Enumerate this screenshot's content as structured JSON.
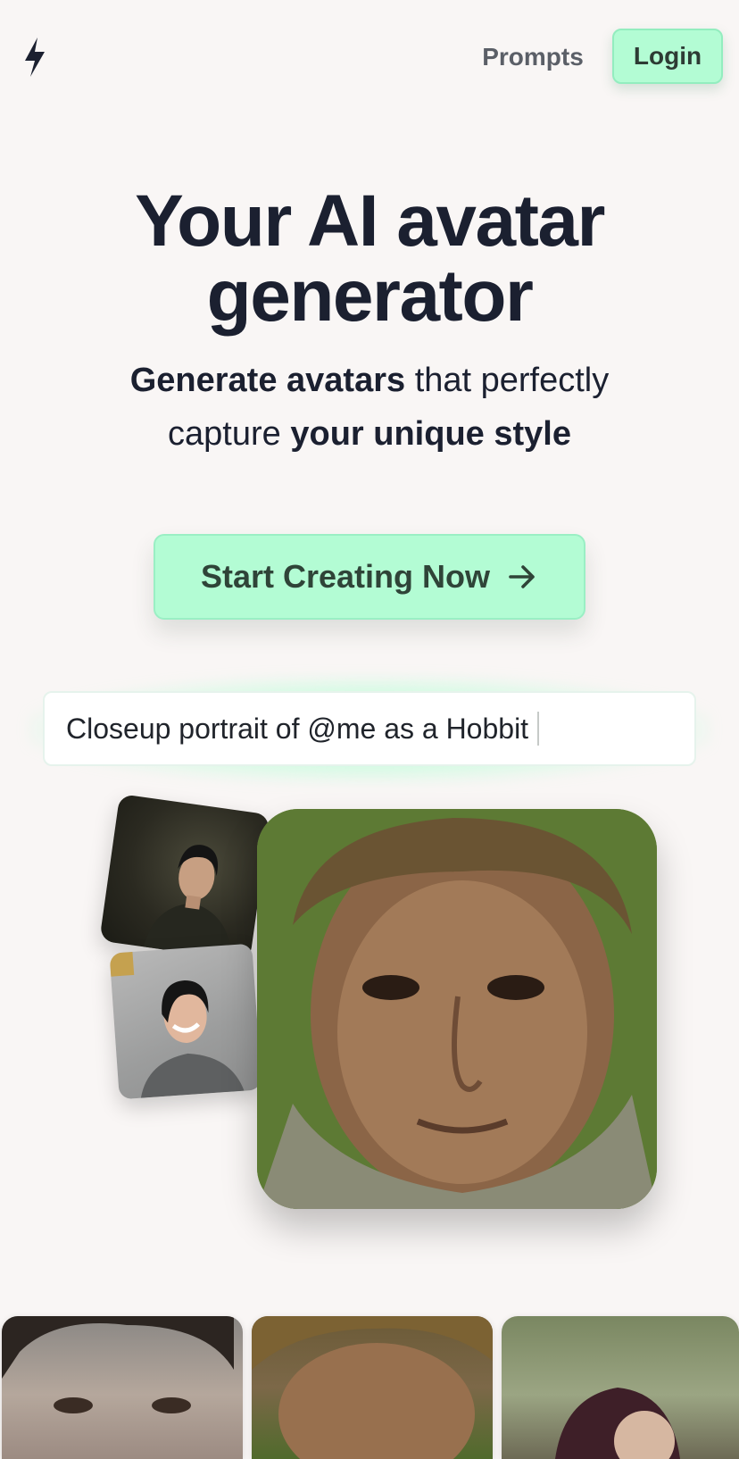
{
  "header": {
    "logo_icon": "lightning-bolt-icon",
    "nav_prompts": "Prompts",
    "login_label": "Login"
  },
  "hero": {
    "title_line1": "Your AI avatar",
    "title_line2": "generator",
    "subtitle": {
      "bold1": "Generate avatars",
      "text1": " that perfectly",
      "text2": "capture ",
      "bold2": "your unique style"
    },
    "cta_label": "Start Creating Now",
    "cta_icon": "arrow-right-icon"
  },
  "prompt": {
    "value": "Closeup portrait of @me as a Hobbit"
  },
  "colors": {
    "background": "#f9f6f5",
    "accent": "#b3fcd4",
    "text": "#1b2030"
  }
}
